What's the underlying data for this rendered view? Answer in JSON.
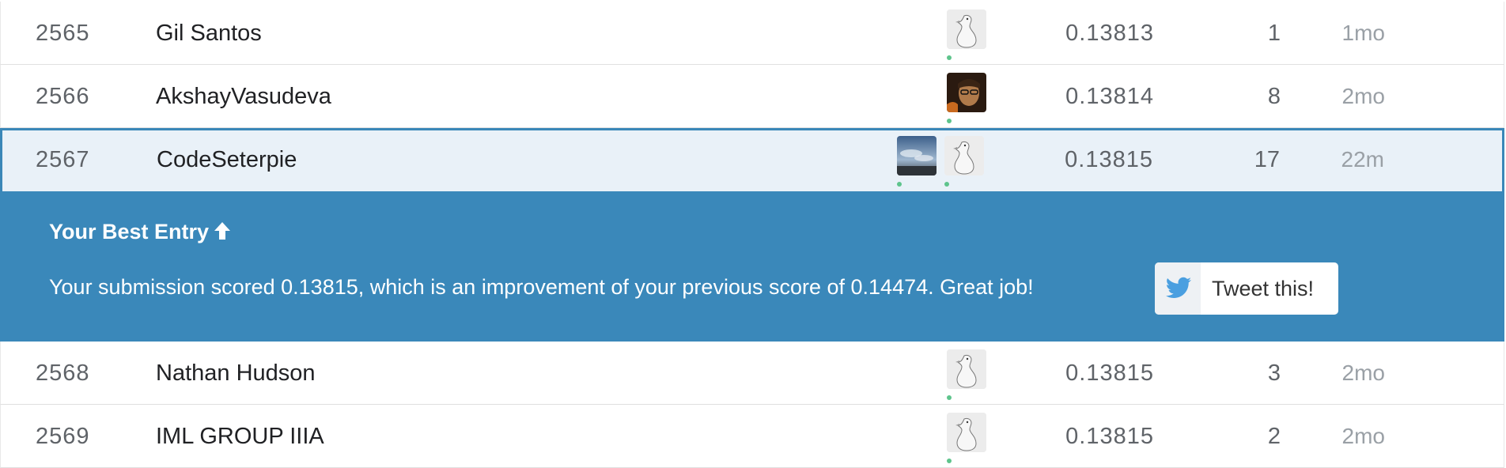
{
  "rows_before": [
    {
      "rank": "2565",
      "team": "Gil Santos",
      "score": "0.13813",
      "entries": "1",
      "last": "1mo",
      "avatars": [
        "goose"
      ]
    },
    {
      "rank": "2566",
      "team": "AkshayVasudeva",
      "score": "0.13814",
      "entries": "8",
      "last": "2mo",
      "avatars": [
        "person-photo"
      ]
    }
  ],
  "my_row": {
    "rank": "2567",
    "team": "CodeSeterpie",
    "score": "0.13815",
    "entries": "17",
    "last": "22m",
    "avatars": [
      "sky-photo",
      "goose"
    ]
  },
  "banner": {
    "title": "Your Best Entry",
    "message": "Your submission scored 0.13815, which is an improvement of your previous score of 0.14474. Great job!",
    "tweet_label": "Tweet this!"
  },
  "rows_after": [
    {
      "rank": "2568",
      "team": "Nathan Hudson",
      "score": "0.13815",
      "entries": "3",
      "last": "2mo",
      "avatars": [
        "goose"
      ]
    },
    {
      "rank": "2569",
      "team": "IML GROUP IIIA",
      "score": "0.13815",
      "entries": "2",
      "last": "2mo",
      "avatars": [
        "goose"
      ]
    }
  ],
  "colors": {
    "banner": "#3a88ba",
    "highlight_bg": "#e9f1f8",
    "highlight_border": "#3a87b8",
    "online_dot": "#5ec48c"
  }
}
